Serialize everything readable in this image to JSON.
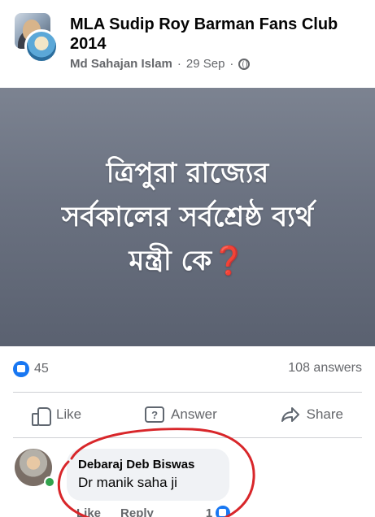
{
  "post": {
    "group_name": "MLA Sudip Roy Barman Fans Club 2014",
    "author": "Md Sahajan Islam",
    "separator": "·",
    "date": "29 Sep",
    "image_text": {
      "line1": "ত্রিপুরা রাজ্যের",
      "line2": "সর্বকালের সর্বশ্রেষ্ঠ ব্যর্থ",
      "line3": "মন্ত্রী কে",
      "mark": "❓"
    }
  },
  "stats": {
    "reaction_count": "45",
    "answers": "108 answers"
  },
  "actions": {
    "like": "Like",
    "answer": "Answer",
    "answer_icon_glyph": "?",
    "share": "Share"
  },
  "comment": {
    "name": "Debaraj Deb Biswas",
    "text": "Dr manik saha ji",
    "like_label": "Like",
    "reply_label": "Reply",
    "like_count": "1"
  },
  "colors": {
    "facebook_blue": "#1877f2",
    "annotation_red": "#d8262a",
    "online_green": "#31a24c"
  }
}
